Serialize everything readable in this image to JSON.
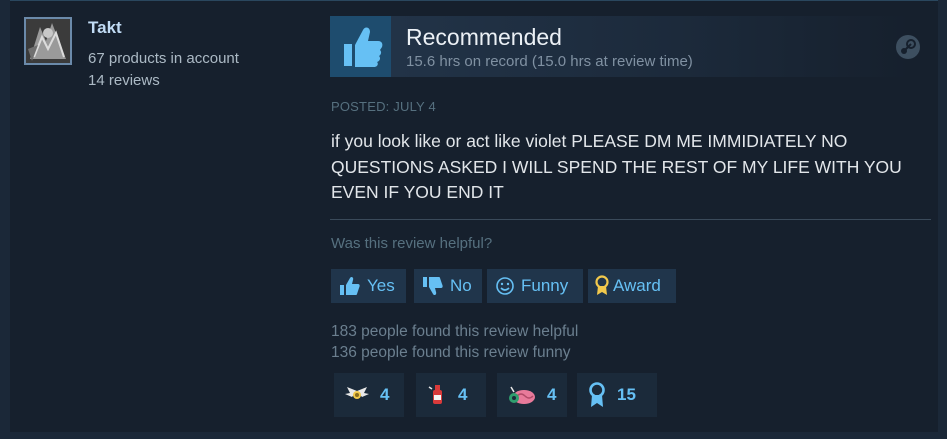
{
  "author": {
    "name": "Takt",
    "products": "67 products in account",
    "reviews": "14 reviews"
  },
  "review": {
    "verdict": "Recommended",
    "hours": "15.6 hrs on record (15.0 hrs at review time)",
    "posted": "POSTED: JULY 4",
    "text": "if you look like or act like violet PLEASE DM ME IMMIDIATELY NO QUESTIONS ASKED I WILL SPEND THE REST OF MY LIFE WITH YOU EVEN IF YOU END IT"
  },
  "feedback": {
    "question": "Was this review helpful?",
    "yes_label": "Yes",
    "no_label": "No",
    "funny_label": "Funny",
    "award_label": "Award",
    "helpful_count_text": "183 people found this review helpful",
    "funny_count_text": "136 people found this review funny"
  },
  "awards": [
    {
      "icon": "wings-award-icon",
      "count": "4"
    },
    {
      "icon": "bottle-award-icon",
      "count": "4"
    },
    {
      "icon": "brain-award-icon",
      "count": "4"
    },
    {
      "icon": "ribbon-award-icon",
      "count": "15"
    }
  ],
  "colors": {
    "link": "#66c0f4",
    "thumb_up": "#66c0f4",
    "award_gold": "#f2c94c"
  }
}
